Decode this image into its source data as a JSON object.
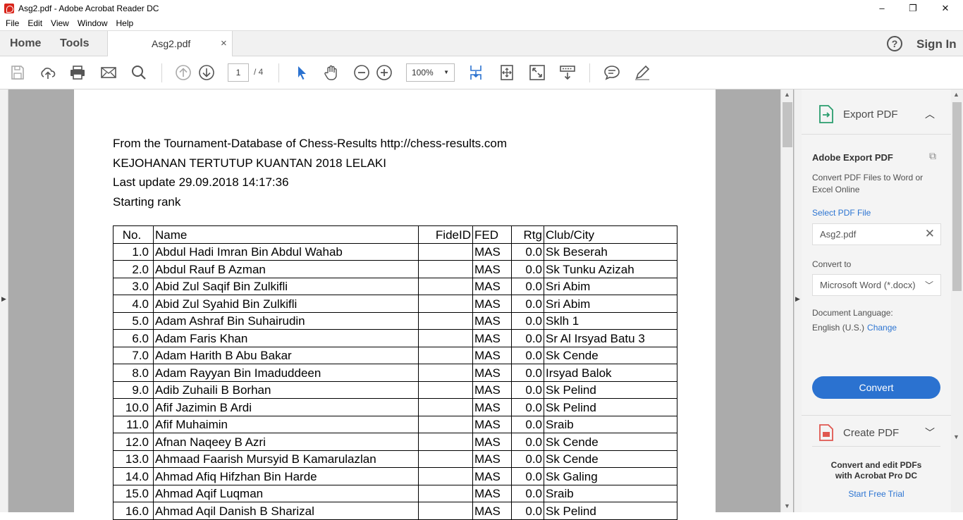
{
  "window": {
    "title": "Asg2.pdf - Adobe Acrobat Reader DC",
    "minimize": "–",
    "maximize": "❐",
    "close": "✕"
  },
  "menu": [
    "File",
    "Edit",
    "View",
    "Window",
    "Help"
  ],
  "tabs": {
    "home": "Home",
    "tools": "Tools",
    "document": "Asg2.pdf",
    "document_close": "×",
    "help": "?",
    "sign_in": "Sign In"
  },
  "toolbar": {
    "page_current": "1",
    "page_total": "/ 4",
    "zoom": "100%"
  },
  "document": {
    "lines": [
      "From the Tournament-Database of Chess-Results http://chess-results.com",
      "KEJOHANAN TERTUTUP KUANTAN 2018 LELAKI",
      "Last update 29.09.2018 14:17:36",
      "Starting rank"
    ],
    "table": {
      "headers": [
        "No.",
        "Name",
        "FideID",
        "FED",
        "Rtg",
        "Club/City"
      ],
      "rows": [
        [
          "1.0",
          "Abdul Hadi Imran Bin Abdul Wahab",
          "",
          "MAS",
          "0.0",
          "Sk Beserah"
        ],
        [
          "2.0",
          "Abdul Rauf B Azman",
          "",
          "MAS",
          "0.0",
          "Sk Tunku Azizah"
        ],
        [
          "3.0",
          "Abid Zul Saqif Bin Zulkifli",
          "",
          "MAS",
          "0.0",
          "Sri Abim"
        ],
        [
          "4.0",
          "Abid Zul Syahid Bin Zulkifli",
          "",
          "MAS",
          "0.0",
          "Sri Abim"
        ],
        [
          "5.0",
          "Adam Ashraf Bin Suhairudin",
          "",
          "MAS",
          "0.0",
          "Sklh 1"
        ],
        [
          "6.0",
          "Adam Faris Khan",
          "",
          "MAS",
          "0.0",
          "Sr Al Irsyad Batu 3"
        ],
        [
          "7.0",
          "Adam Harith B Abu Bakar",
          "",
          "MAS",
          "0.0",
          "Sk Cende"
        ],
        [
          "8.0",
          "Adam Rayyan Bin Imaduddeen",
          "",
          "MAS",
          "0.0",
          "Irsyad Balok"
        ],
        [
          "9.0",
          "Adib Zuhaili B Borhan",
          "",
          "MAS",
          "0.0",
          "Sk Pelind"
        ],
        [
          "10.0",
          "Afif Jazimin B Ardi",
          "",
          "MAS",
          "0.0",
          "Sk Pelind"
        ],
        [
          "11.0",
          "Afif Muhaimin",
          "",
          "MAS",
          "0.0",
          "Sraib"
        ],
        [
          "12.0",
          "Afnan Naqeey B Azri",
          "",
          "MAS",
          "0.0",
          "Sk Cende"
        ],
        [
          "13.0",
          "Ahmaad Faarish Mursyid B Kamarulazlan",
          "",
          "MAS",
          "0.0",
          "Sk Cende"
        ],
        [
          "14.0",
          "Ahmad Afiq Hifzhan Bin Harde",
          "",
          "MAS",
          "0.0",
          "Sk Galing"
        ],
        [
          "15.0",
          "Ahmad Aqif Luqman",
          "",
          "MAS",
          "0.0",
          "Sraib"
        ],
        [
          "16.0",
          "Ahmad Aqil Danish B Sharizal",
          "",
          "MAS",
          "0.0",
          "Sk Pelind"
        ]
      ]
    }
  },
  "right_panel": {
    "export_pdf": "Export PDF",
    "adobe_export_title": "Adobe Export PDF",
    "description": "Convert PDF Files to Word or Excel Online",
    "select_file": "Select PDF File",
    "file_name": "Asg2.pdf",
    "convert_to_label": "Convert to",
    "convert_to_value": "Microsoft Word (*.docx)",
    "doc_language_label": "Document Language:",
    "doc_language_value": "English (U.S.)",
    "change": "Change",
    "convert_button": "Convert",
    "create_pdf": "Create PDF",
    "promo": "Convert and edit PDFs with Acrobat Pro DC",
    "free_trial": "Start Free Trial"
  },
  "colors": {
    "accent_blue": "#2b72d0",
    "link_blue": "#2d75d2",
    "viewer_gray": "#ababab"
  }
}
